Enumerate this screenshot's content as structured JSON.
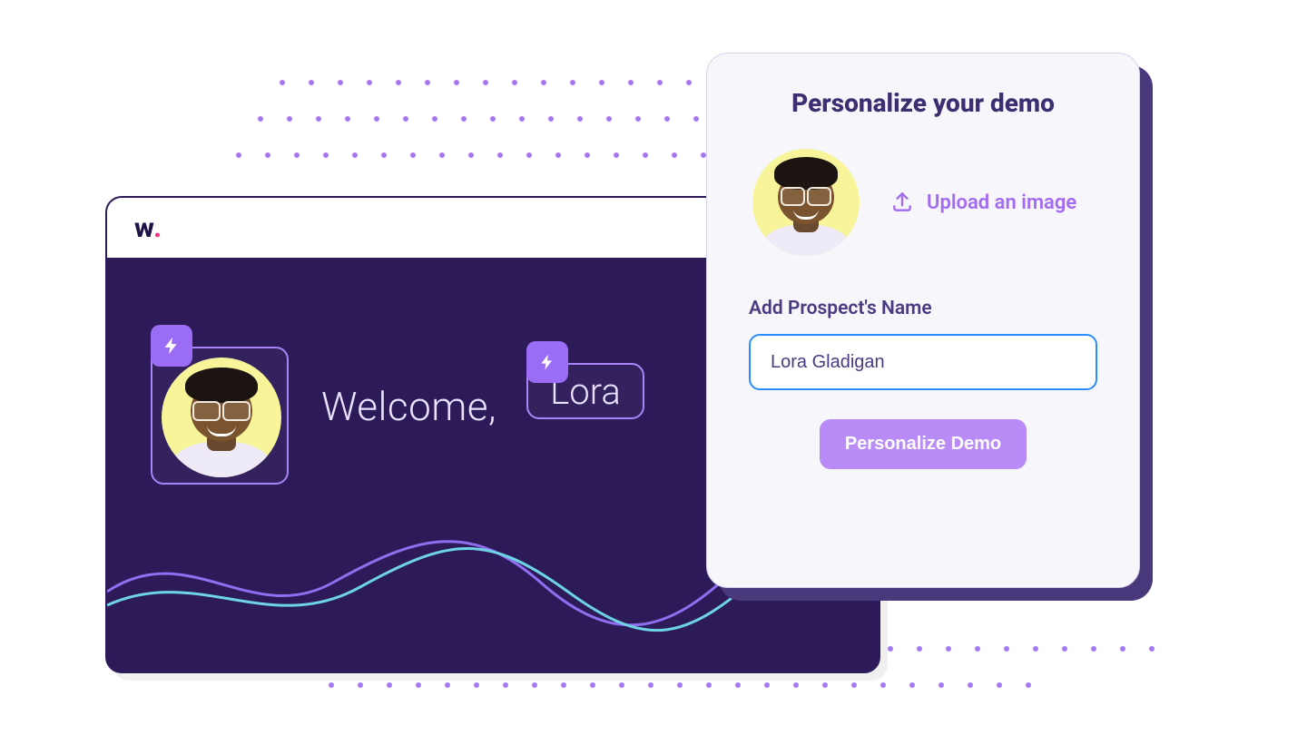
{
  "window": {
    "logo_text": "w",
    "logo_dot": ".",
    "welcome_label": "Welcome,",
    "name_token": "Lora"
  },
  "card": {
    "title": "Personalize your demo",
    "upload_label": "Upload an image",
    "name_field_label": "Add Prospect's Name",
    "name_value": "Lora Gladigan",
    "cta_label": "Personalize Demo"
  },
  "colors": {
    "accent": "#9b6cf6",
    "card_shadow": "#4a387c",
    "input_border": "#2a8cff"
  }
}
